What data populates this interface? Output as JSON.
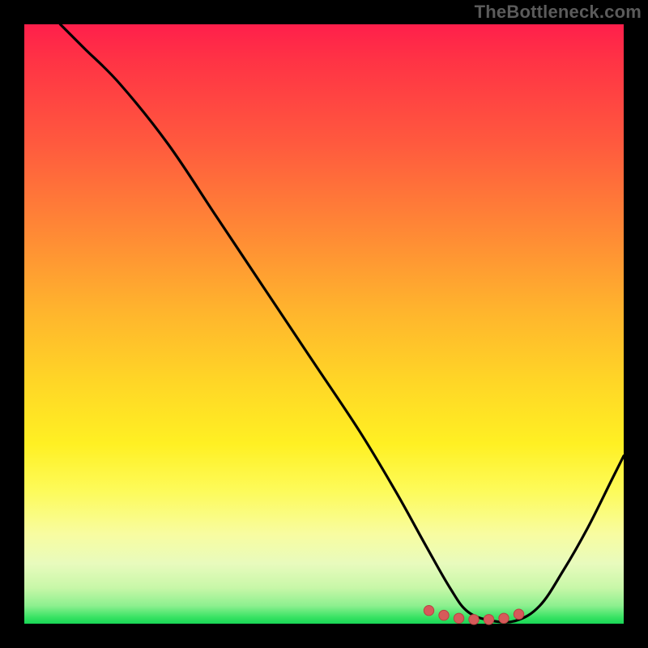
{
  "watermark": "TheBottleneck.com",
  "colors": {
    "frame_background": "#000000",
    "gradient_top": "#ff1f4b",
    "gradient_bottom": "#18d656",
    "curve": "#000000",
    "marker_fill": "#d65a5a",
    "marker_stroke": "#b94343"
  },
  "chart_data": {
    "type": "line",
    "title": "",
    "xlabel": "",
    "ylabel": "",
    "xlim": [
      0,
      100
    ],
    "ylim": [
      0,
      100
    ],
    "grid": false,
    "legend": false,
    "note": "Axes are unitless percentages inferred from the plot area. y=100 is the top of the colored area, y=0 is the bottom edge.",
    "series": [
      {
        "name": "bottleneck-curve",
        "x": [
          6,
          10,
          16,
          24,
          32,
          40,
          48,
          56,
          62,
          67,
          71,
          74,
          78,
          82,
          86,
          90,
          94,
          98,
          100
        ],
        "y": [
          100,
          96,
          90,
          80,
          68,
          56,
          44,
          32,
          22,
          13,
          6,
          2,
          0.5,
          0.5,
          3,
          9,
          16,
          24,
          28
        ]
      }
    ],
    "markers": {
      "name": "valley-highlight",
      "x": [
        67.5,
        70,
        72.5,
        75,
        77.5,
        80,
        82.5
      ],
      "y": [
        2.2,
        1.4,
        0.9,
        0.7,
        0.7,
        0.9,
        1.6
      ]
    }
  }
}
